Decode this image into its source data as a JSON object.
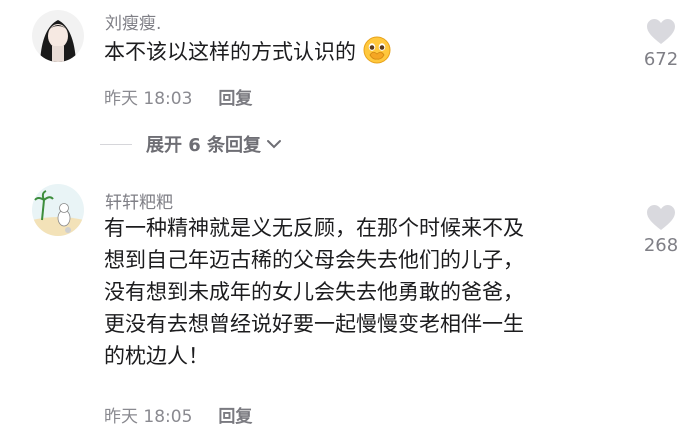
{
  "comments": [
    {
      "username": "刘瘦瘦.",
      "text_lines": [
        "本不该以这样的方式认识的"
      ],
      "emoji": "pleading-face-hands-over-mouth",
      "time": "昨天 18:03",
      "reply_label": "回复",
      "likes": "672"
    },
    {
      "username": "轩轩粑粑",
      "text_lines": [
        "有一种精神就是义无反顾，在那个时候来不及",
        "想到自己年迈古稀的父母会失去他们的儿子，",
        "没有想到未成年的女儿会失去他勇敢的爸爸，",
        "更没有去想曾经说好要一起慢慢变老相伴一生",
        "的枕边人！"
      ],
      "time": "昨天 18:05",
      "reply_label": "回复",
      "likes": "268"
    }
  ],
  "expand_replies": {
    "label": "展开 6 条回复"
  },
  "colors": {
    "like_icon": "#d9d9de",
    "username": "#7f7f86",
    "body": "#1c1c1e"
  }
}
